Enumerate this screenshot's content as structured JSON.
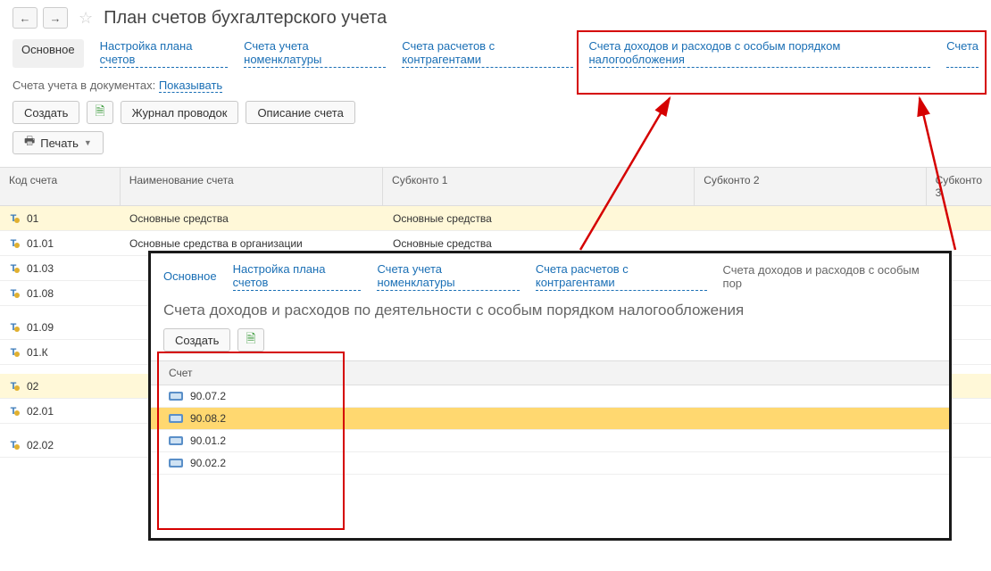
{
  "header": {
    "title": "План счетов бухгалтерского учета"
  },
  "tabs": {
    "main": "Основное",
    "t1": "Настройка плана счетов",
    "t2": "Счета учета номенклатуры",
    "t3": "Счета расчетов с контрагентами",
    "t4": "Счета доходов и расходов с особым порядком налогообложения",
    "t5": "Счета"
  },
  "subline": {
    "label": "Счета учета в документах:",
    "link": "Показывать"
  },
  "toolbar": {
    "create": "Создать",
    "journal": "Журнал проводок",
    "desc": "Описание счета",
    "print": "Печать"
  },
  "table": {
    "h_code": "Код счета",
    "h_name": "Наименование счета",
    "h_sk1": "Субконто 1",
    "h_sk2": "Субконто 2",
    "h_sk3": "Субконто 3",
    "rows": [
      {
        "code": "01",
        "name": "Основные средства",
        "sk1": "Основные средства",
        "sel": true
      },
      {
        "code": "01.01",
        "name": "Основные средства в организации",
        "sk1": "Основные средства"
      },
      {
        "code": "01.03",
        "name": "",
        "sk1": ""
      },
      {
        "code": "01.08",
        "name": "",
        "sk1": ""
      },
      {
        "code": "01.09",
        "name": "",
        "sk1": ""
      },
      {
        "code": "01.К",
        "name": "",
        "sk1": ""
      },
      {
        "code": "02",
        "name": "",
        "sk1": "",
        "sel": true
      },
      {
        "code": "02.01",
        "name": "",
        "sk1": ""
      },
      {
        "code": "02.02",
        "name": "",
        "sk1": ""
      }
    ]
  },
  "panel": {
    "tabs": {
      "main": "Основное",
      "t1": "Настройка плана счетов",
      "t2": "Счета учета номенклатуры",
      "t3": "Счета расчетов с контрагентами",
      "cur": "Счета доходов и расходов с особым пор"
    },
    "heading": "Счета доходов и расходов по деятельности с особым порядком налогообложения",
    "create": "Создать",
    "list_head": "Счет",
    "rows": [
      {
        "v": "90.07.2"
      },
      {
        "v": "90.08.2",
        "sel": true
      },
      {
        "v": "90.01.2"
      },
      {
        "v": "90.02.2"
      }
    ]
  }
}
